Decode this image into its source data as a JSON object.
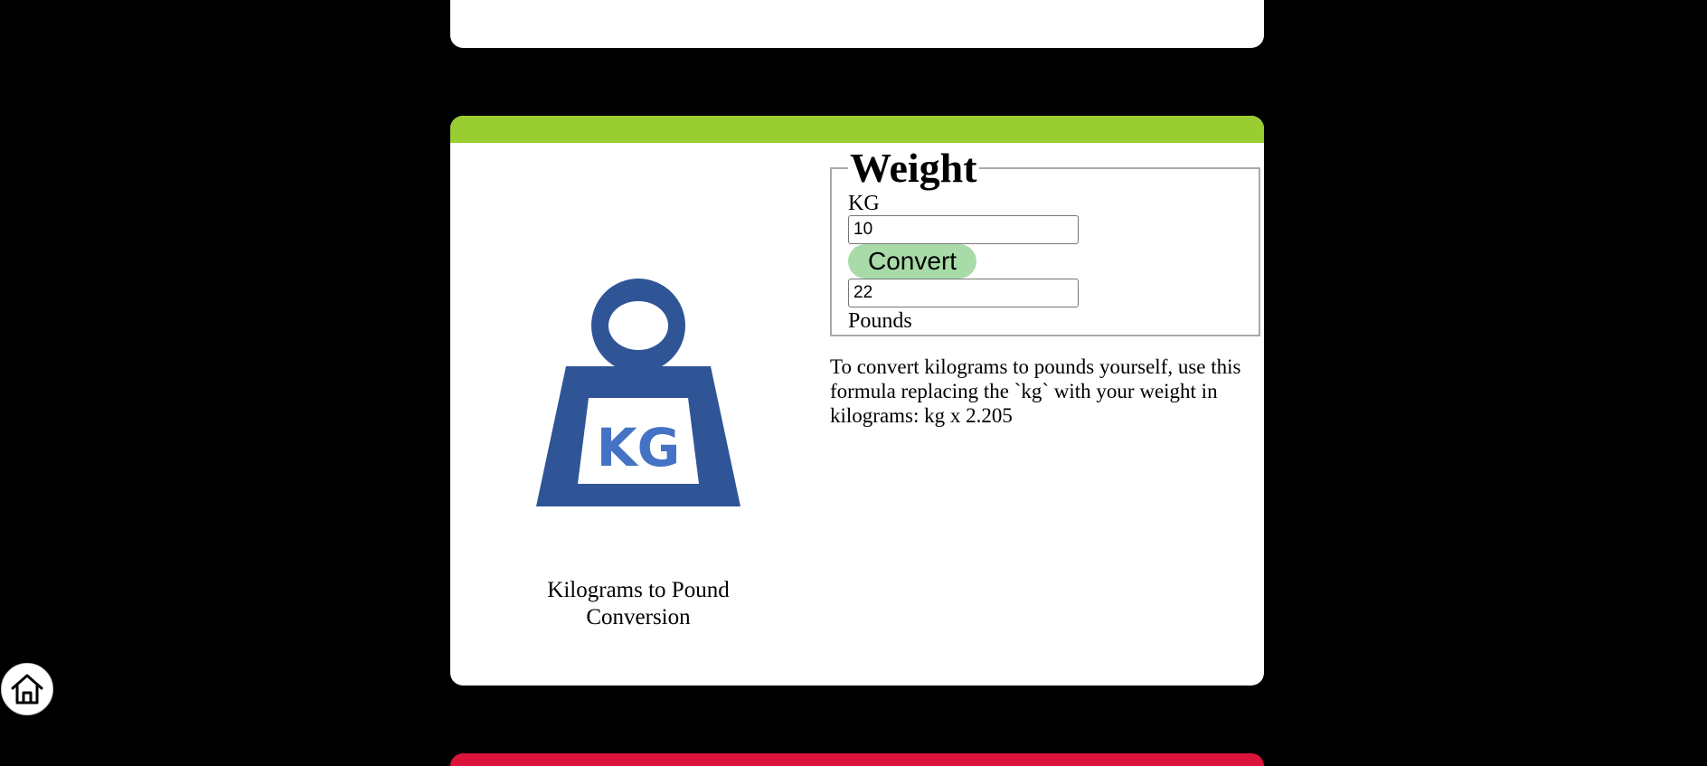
{
  "converter": {
    "caption": "Kilograms to Pound Conversion",
    "legend": "Weight",
    "input_label": "KG",
    "input_value": "10",
    "button_label": "Convert",
    "output_value": "22",
    "output_label": "Pounds",
    "formula_text": "To convert kilograms to pounds yourself, use this formula replacing the `kg` with your weight in kilograms: kg x 2.205",
    "icon_text": "KG"
  },
  "colors": {
    "background": "#000000",
    "card_header_green": "#9acd32",
    "next_card_header_red": "#dc143c",
    "weight_icon_blue": "#2f5597",
    "button_green": "#a8dba8"
  },
  "icons": {
    "weight": "kettlebell-kg-icon",
    "home": "home-icon"
  }
}
